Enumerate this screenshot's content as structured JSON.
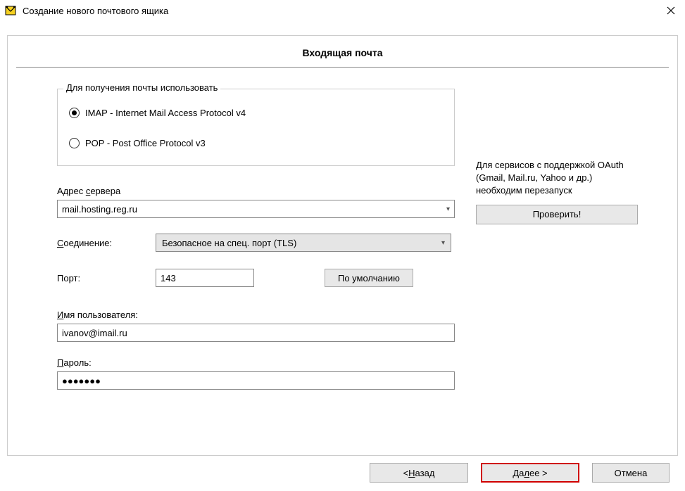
{
  "window": {
    "title": "Создание нового почтового ящика"
  },
  "page": {
    "heading": "Входящая почта"
  },
  "protocol": {
    "legend": "Для получения почты использовать",
    "imap_label": "IMAP - Internet Mail Access Protocol v4",
    "pop_label": "POP  -  Post Office Protocol v3",
    "selected": "imap"
  },
  "server": {
    "label_pre": "Адрес ",
    "label_und": "с",
    "label_post": "ервера",
    "value": "mail.hosting.reg.ru"
  },
  "connection": {
    "label_und": "С",
    "label_post": "оединение:",
    "value": "Безопасное на спец. порт (TLS)"
  },
  "port": {
    "label": "Порт:",
    "value": "143",
    "default_btn": "По умолчанию"
  },
  "username": {
    "label_und": "И",
    "label_post": "мя пользователя:",
    "value": "ivanov@imail.ru"
  },
  "password": {
    "label_und": "П",
    "label_post": "ароль:",
    "value": "●●●●●●●"
  },
  "oauth": {
    "hint": "Для сервисов с поддержкой OAuth (Gmail, Mail.ru, Yahoo и др.) необходим перезапуск",
    "verify": "Проверить!"
  },
  "footer": {
    "back_pre": "<  ",
    "back_und": "Н",
    "back_post": "азад",
    "next_pre": "Да",
    "next_und": "л",
    "next_post": "ее   >",
    "cancel": "Отмена"
  }
}
